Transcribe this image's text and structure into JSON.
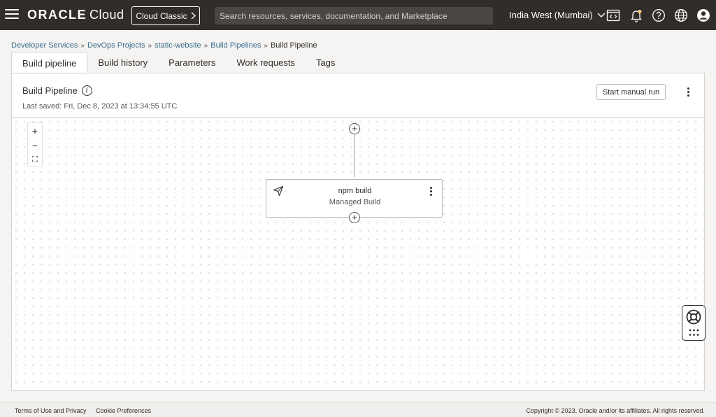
{
  "header": {
    "logo_oracle": "ORACLE",
    "logo_cloud": "Cloud",
    "classic_button": "Cloud Classic",
    "search_placeholder": "Search resources, services, documentation, and Marketplace",
    "region": "India West (Mumbai)",
    "icons": [
      "code-editor-icon",
      "notifications-icon",
      "help-icon",
      "language-icon",
      "profile-icon"
    ]
  },
  "breadcrumb": {
    "items": [
      "Developer Services",
      "DevOps Projects",
      "static-website",
      "Build Pipelines"
    ],
    "current": "Build Pipeline"
  },
  "tabs": [
    "Build pipeline",
    "Build history",
    "Parameters",
    "Work requests",
    "Tags"
  ],
  "active_tab": "Build pipeline",
  "panel": {
    "title": "Build Pipeline",
    "info_glyph": "i",
    "last_saved": "Last saved: Fri, Dec 8, 2023 at 13:34:55 UTC",
    "start_button": "Start manual run"
  },
  "canvas": {
    "zoom_in": "+",
    "zoom_out": "−",
    "fit": "⛶",
    "add_glyph": "+",
    "stage": {
      "name": "npm build",
      "type": "Managed Build"
    }
  },
  "footer": {
    "terms": "Terms of Use and Privacy",
    "cookies": "Cookie Preferences",
    "copyright": "Copyright © 2023, Oracle and/or its affiliates. All rights reserved."
  },
  "colors": {
    "topbar": "#312d2a",
    "link": "#3a6b8e",
    "background": "#f1efed"
  }
}
